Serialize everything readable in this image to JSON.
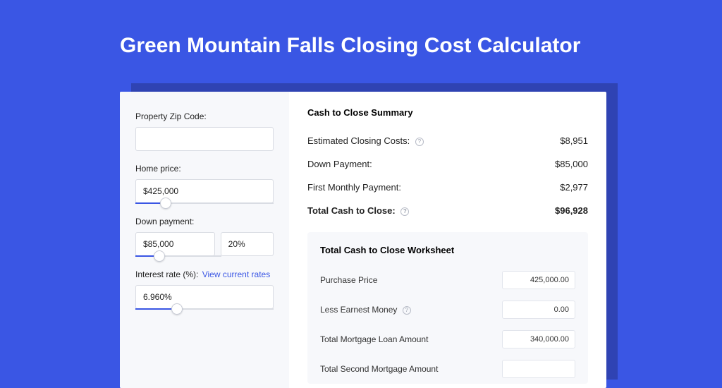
{
  "title": "Green Mountain Falls Closing Cost Calculator",
  "left": {
    "zip_label": "Property Zip Code:",
    "zip_value": "",
    "home_price_label": "Home price:",
    "home_price_value": "$425,000",
    "home_price_slider_pct": 22,
    "down_payment_label": "Down payment:",
    "down_payment_value": "$85,000",
    "down_payment_pct": "20%",
    "down_payment_slider_pct": 28,
    "interest_label": "Interest rate (%):",
    "interest_link": "View current rates",
    "interest_value": "6.960%",
    "interest_slider_pct": 30
  },
  "summary": {
    "title": "Cash to Close Summary",
    "rows": [
      {
        "label": "Estimated Closing Costs:",
        "help": true,
        "value": "$8,951",
        "bold": false
      },
      {
        "label": "Down Payment:",
        "help": false,
        "value": "$85,000",
        "bold": false
      },
      {
        "label": "First Monthly Payment:",
        "help": false,
        "value": "$2,977",
        "bold": false
      },
      {
        "label": "Total Cash to Close:",
        "help": true,
        "value": "$96,928",
        "bold": true
      }
    ]
  },
  "worksheet": {
    "title": "Total Cash to Close Worksheet",
    "rows": [
      {
        "label": "Purchase Price",
        "help": false,
        "value": "425,000.00"
      },
      {
        "label": "Less Earnest Money",
        "help": true,
        "value": "0.00"
      },
      {
        "label": "Total Mortgage Loan Amount",
        "help": false,
        "value": "340,000.00"
      },
      {
        "label": "Total Second Mortgage Amount",
        "help": false,
        "value": ""
      }
    ]
  }
}
